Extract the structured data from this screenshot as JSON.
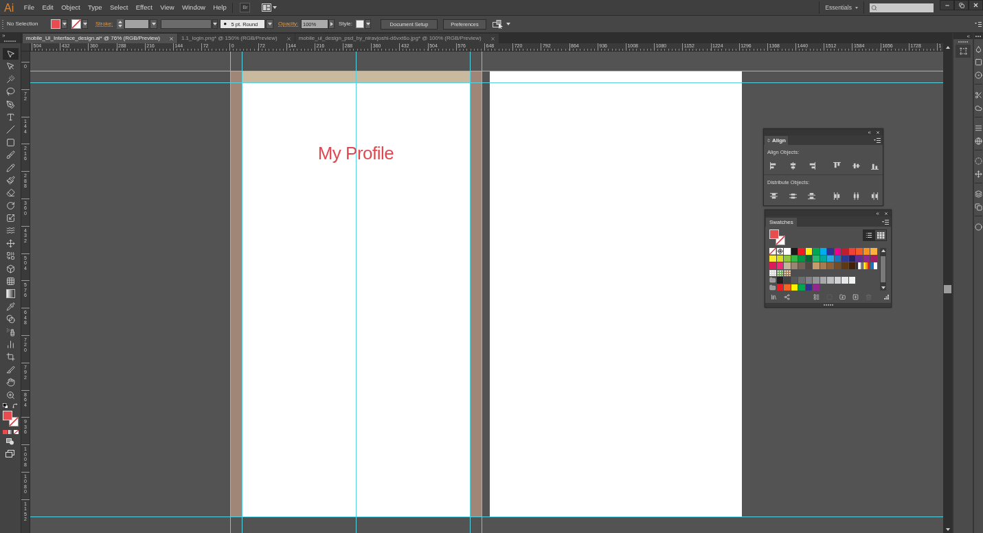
{
  "menu_bar": {
    "logo": "Ai",
    "items": [
      "File",
      "Edit",
      "Object",
      "Type",
      "Select",
      "Effect",
      "View",
      "Window",
      "Help"
    ],
    "bridge": "Br",
    "workspace": "Essentials"
  },
  "control_bar": {
    "selection": "No Selection",
    "fill": {
      "color": "#e84c4f"
    },
    "stroke": {
      "kind": "none"
    },
    "stroke_label": "Stroke:",
    "brush": "5 pt. Round",
    "opacity_label": "Opacity:",
    "opacity": "100%",
    "style_label": "Style:",
    "buttons": [
      "Document Setup",
      "Preferences"
    ]
  },
  "tabs": [
    {
      "label": "mobile_Ui_Interface_design.ai* @ 76% (RGB/Preview)",
      "selected": true
    },
    {
      "label": "1.1_login.png* @ 150% (RGB/Preview)",
      "selected": false
    },
    {
      "label": "mobile_ui_design_psd_by_niravjoshi-d6vxt6o.jpg* @ 100% (RGB/Preview)",
      "selected": false
    }
  ],
  "rulers": {
    "horizontal": [
      "504",
      "432",
      "360",
      "288",
      "216",
      "144",
      "72",
      "0",
      "72",
      "144",
      "216",
      "288",
      "360",
      "432",
      "504",
      "576",
      "648",
      "720",
      "792",
      "864",
      "936",
      "1008",
      "1080",
      "1152",
      "1224",
      "1296",
      "1368",
      "1440",
      "1512",
      "1584",
      "1656",
      "1728",
      "1"
    ],
    "vertical": [
      "0",
      "72",
      "144",
      "216",
      "288",
      "360",
      "432",
      "504",
      "576",
      "648",
      "720",
      "792",
      "864",
      "936",
      "1008",
      "1080",
      "1152"
    ]
  },
  "toolbox": {
    "tools": [
      {
        "selected": true
      },
      {
        "selected": false
      },
      {
        "selected": false
      },
      {
        "selected": false
      },
      {
        "selected": false
      },
      {
        "selected": false
      },
      {
        "selected": false
      },
      {
        "selected": false
      },
      {
        "selected": false
      },
      {
        "selected": false
      },
      {
        "selected": false
      },
      {
        "selected": false
      },
      {
        "selected": false
      },
      {
        "selected": false
      },
      {
        "selected": false
      },
      {
        "selected": false
      },
      {
        "selected": false
      },
      {
        "selected": false
      },
      {
        "selected": false
      },
      {
        "selected": false
      },
      {
        "selected": false
      },
      {
        "selected": false
      },
      {
        "selected": false
      },
      {
        "selected": false
      },
      {
        "selected": false
      },
      {
        "selected": false
      },
      {
        "selected": false
      },
      {
        "selected": false
      }
    ],
    "fill": {
      "color": "#e84c4f"
    },
    "stroke": {
      "kind": "none"
    }
  },
  "artboards": [
    {
      "kind": "profile",
      "title": "My Profile"
    },
    {
      "kind": "blank"
    }
  ],
  "align_panel": {
    "title": "Align",
    "sections": [
      {
        "label": "Align Objects:"
      },
      {
        "label": "Distribute Objects:"
      }
    ]
  },
  "swatches_panel": {
    "title": "Swatches",
    "fill": {
      "color": "#e84c4f"
    },
    "stroke": {
      "kind": "none"
    },
    "view_modes": [
      {
        "selected": true
      },
      {
        "selected": false
      }
    ],
    "swatches": [
      {
        "kind": "none"
      },
      {
        "kind": "registration"
      },
      {
        "kind": "color",
        "color": "#ffffff"
      },
      {
        "kind": "color",
        "color": "#1a1a1a"
      },
      {
        "kind": "color",
        "color": "#ed1c24"
      },
      {
        "kind": "color",
        "color": "#fff200"
      },
      {
        "kind": "color",
        "color": "#00a651"
      },
      {
        "kind": "color",
        "color": "#00aeef"
      },
      {
        "kind": "color",
        "color": "#2e3192"
      },
      {
        "kind": "color",
        "color": "#ec008c"
      },
      {
        "kind": "color",
        "color": "#be1e2d"
      },
      {
        "kind": "color",
        "color": "#ef4136"
      },
      {
        "kind": "color",
        "color": "#f15a29"
      },
      {
        "kind": "color",
        "color": "#f7941d"
      },
      {
        "kind": "color",
        "color": "#fbb040"
      },
      {
        "kind": "color",
        "color": "#f9ed32"
      },
      {
        "kind": "color",
        "color": "#d7df23"
      },
      {
        "kind": "color",
        "color": "#8dc63f"
      },
      {
        "kind": "color",
        "color": "#39b54a"
      },
      {
        "kind": "color",
        "color": "#009444"
      },
      {
        "kind": "color",
        "color": "#006838"
      },
      {
        "kind": "color",
        "color": "#2bb673"
      },
      {
        "kind": "color",
        "color": "#00a79d"
      },
      {
        "kind": "color",
        "color": "#27aae1"
      },
      {
        "kind": "color",
        "color": "#1c75bc"
      },
      {
        "kind": "color",
        "color": "#2b3990"
      },
      {
        "kind": "color",
        "color": "#262262"
      },
      {
        "kind": "color",
        "color": "#662d91"
      },
      {
        "kind": "color",
        "color": "#92278f"
      },
      {
        "kind": "color",
        "color": "#9e1f63"
      },
      {
        "kind": "color",
        "color": "#da1c5c"
      },
      {
        "kind": "color",
        "color": "#ee2a7b"
      },
      {
        "kind": "color",
        "color": "#c2b59b"
      },
      {
        "kind": "color",
        "color": "#998675"
      },
      {
        "kind": "color",
        "color": "#736357"
      },
      {
        "kind": "color",
        "color": "#534741"
      },
      {
        "kind": "color",
        "color": "#c69c6d"
      },
      {
        "kind": "color",
        "color": "#a67c52"
      },
      {
        "kind": "color",
        "color": "#8c6239"
      },
      {
        "kind": "color",
        "color": "#754c24"
      },
      {
        "kind": "color",
        "color": "#603813"
      },
      {
        "kind": "color",
        "color": "#42210b"
      },
      {
        "kind": "gradient",
        "stops": [
          {
            "color": "#333333"
          },
          {
            "color": "#ffffff"
          },
          {
            "color": "#808080"
          }
        ]
      },
      {
        "kind": "gradient",
        "stops": [
          {
            "color": "#fff200"
          },
          {
            "color": "#f7941d"
          },
          {
            "color": "#ed1c24"
          }
        ]
      },
      {
        "kind": "gradient",
        "stops": [
          {
            "color": "#1c75bc"
          },
          {
            "color": "#ffffff"
          }
        ]
      },
      {
        "kind": "pattern",
        "color": "#d9d9d9"
      },
      {
        "kind": "pattern",
        "color": "#6aa84f"
      },
      {
        "kind": "pattern",
        "color": "#a67c52"
      }
    ],
    "groups": [
      {
        "swatches": [
          {
            "color": "#231f20"
          },
          {
            "color": "#414042"
          },
          {
            "color": "#58595b"
          },
          {
            "color": "#6d6e71"
          },
          {
            "color": "#808285"
          },
          {
            "color": "#939598"
          },
          {
            "color": "#a7a9ac"
          },
          {
            "color": "#bcbec0"
          },
          {
            "color": "#d1d3d4"
          },
          {
            "color": "#e6e7e8"
          },
          {
            "color": "#f1f2f2"
          }
        ]
      },
      {
        "swatches": [
          {
            "color": "#ed1c24"
          },
          {
            "color": "#f26522"
          },
          {
            "color": "#fff200"
          },
          {
            "color": "#00a651"
          },
          {
            "color": "#2e3192"
          },
          {
            "color": "#92278f"
          }
        ]
      }
    ],
    "bottom_buttons": [
      {
        "disabled": false
      },
      {
        "disabled": false
      },
      {
        "disabled": false
      },
      {
        "disabled": true
      },
      {
        "disabled": false
      },
      {
        "disabled": false
      },
      {
        "disabled": true
      }
    ]
  }
}
